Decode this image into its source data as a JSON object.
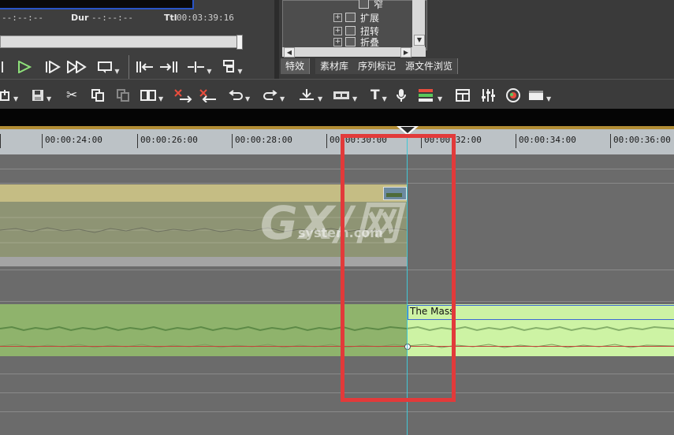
{
  "player": {
    "in_tc": "--:--:--",
    "dur_label": "Dur",
    "dur_tc": "--:--:--",
    "ttl_label": "Ttl",
    "ttl_tc": "00:03:39:16"
  },
  "bin": {
    "tree_items": [
      {
        "label": "窄",
        "has_plus": false
      },
      {
        "label": "扩展",
        "has_plus": true
      },
      {
        "label": "扭转",
        "has_plus": true
      },
      {
        "label": "折叠",
        "has_plus": true
      }
    ],
    "tabs": [
      "特效",
      "素材库",
      "序列标记",
      "源文件浏览"
    ],
    "active_tab": 0
  },
  "timeline": {
    "ruler_ticks": [
      "00:00:24:00",
      "00:00:26:00",
      "00:00:28:00",
      "00:00:30:00",
      "00:00:32:00",
      "00:00:34:00",
      "00:00:36:00"
    ],
    "audio_clip_title": "The Mass"
  },
  "watermark": {
    "main": "GX/网",
    "sub": "system.com"
  },
  "colors": {
    "highlight": "#e23a3a",
    "cursor": "#41c7d5",
    "video_clip": "#c5bd84",
    "audio_clip": "#8fb36c",
    "audio_clip_selected": "#cdf3a4",
    "ruler_accent": "#b28d35"
  }
}
